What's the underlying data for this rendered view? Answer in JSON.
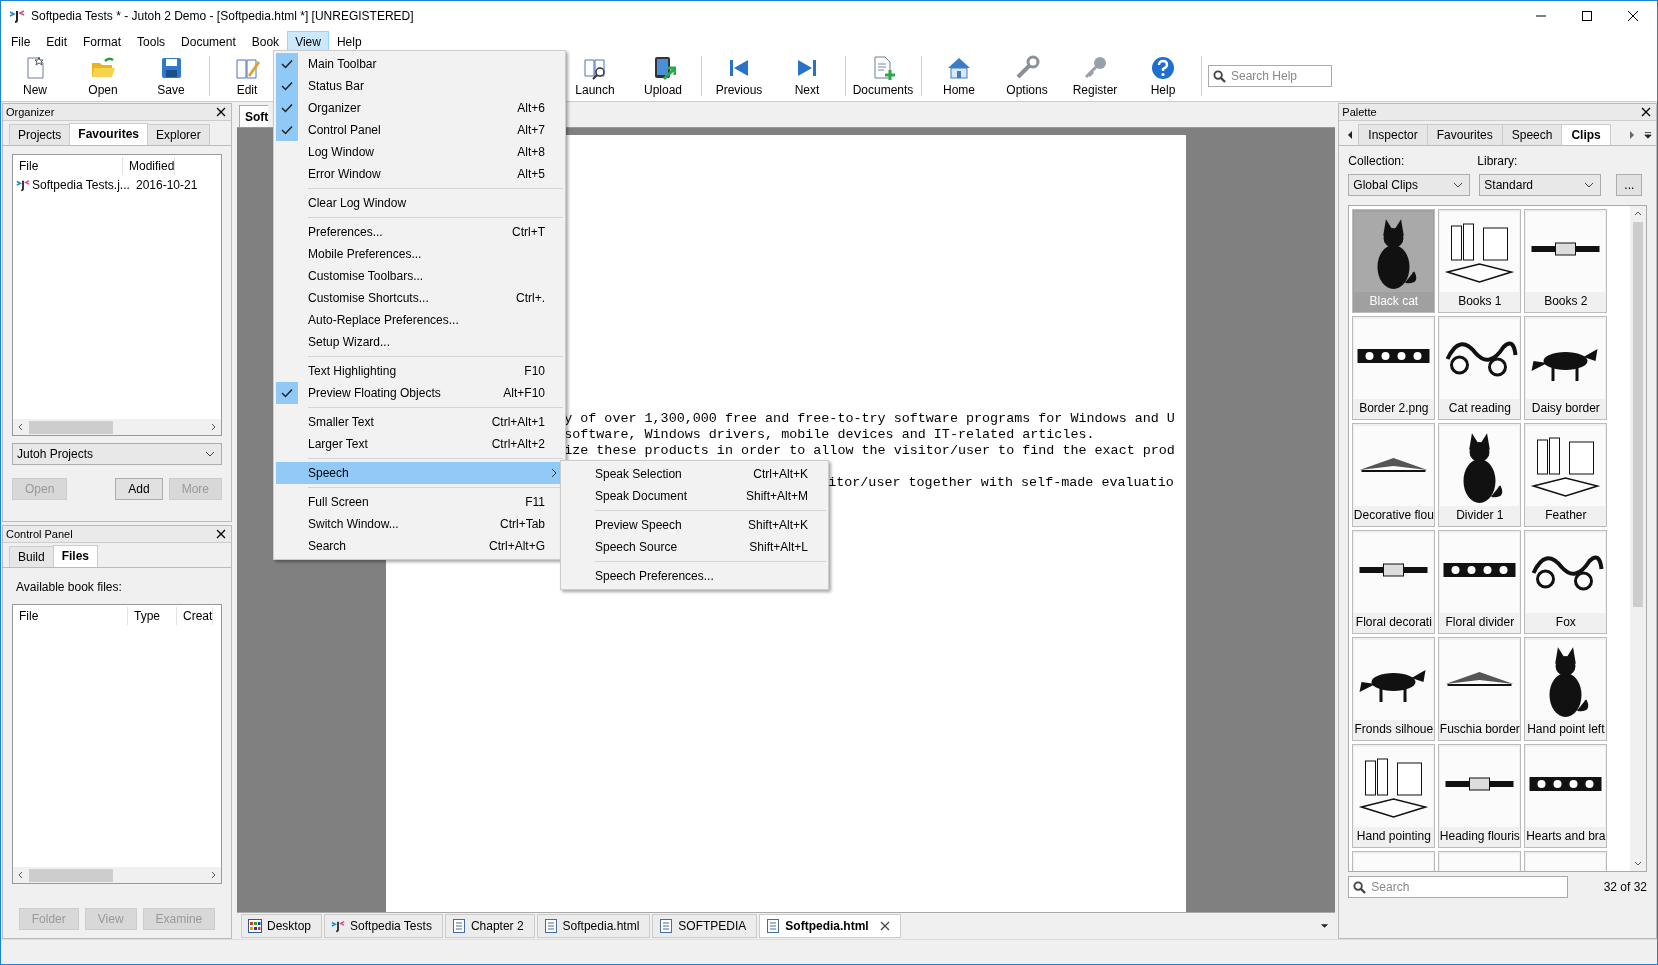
{
  "window": {
    "title": "Softpedia Tests * - Jutoh 2 Demo - [Softpedia.html *] [UNREGISTERED]"
  },
  "menu_bar": [
    {
      "label": "File",
      "selected": false
    },
    {
      "label": "Edit",
      "selected": false
    },
    {
      "label": "Format",
      "selected": false
    },
    {
      "label": "Tools",
      "selected": false
    },
    {
      "label": "Document",
      "selected": false
    },
    {
      "label": "Book",
      "selected": false
    },
    {
      "label": "View",
      "selected": true
    },
    {
      "label": "Help",
      "selected": false
    }
  ],
  "toolbar": {
    "buttons": [
      "New",
      "Open",
      "Save",
      "Edit",
      "Launch",
      "Upload",
      "Previous",
      "Next",
      "Documents",
      "Home",
      "Options",
      "Register",
      "Help"
    ],
    "search": {
      "placeholder": "Search Help"
    }
  },
  "organizer": {
    "title": "Organizer",
    "tabs": [
      {
        "label": "Projects",
        "selected": false
      },
      {
        "label": "Favourites",
        "selected": true
      },
      {
        "label": "Explorer",
        "selected": false
      }
    ],
    "columns": [
      "File",
      "Modified"
    ],
    "rows": [
      {
        "file": "Softpedia Tests.j...",
        "modified": "2016-10-21"
      }
    ],
    "dropdown": "Jutoh Projects",
    "buttons": [
      {
        "label": "Open",
        "disabled": true
      },
      {
        "label": "Add",
        "disabled": false
      },
      {
        "label": "More",
        "disabled": true
      }
    ]
  },
  "control_panel": {
    "title": "Control Panel",
    "tabs": [
      {
        "label": "Build",
        "selected": false
      },
      {
        "label": "Files",
        "selected": true
      }
    ],
    "caption": "Available book files:",
    "columns": [
      "File",
      "Type",
      "Creat"
    ],
    "buttons": [
      {
        "label": "Folder",
        "disabled": true
      },
      {
        "label": "View",
        "disabled": true
      },
      {
        "label": "Examine",
        "disabled": true
      }
    ]
  },
  "document": {
    "tab": "Soft",
    "lines": [
      "y of over 1,300,000 free and free-to-try software programs for Windows and U",
      "software, Windows drivers, mobile devices and IT-related articles.",
      "ize these products in order to allow the visitor/user to find the exact prod",
      "itor/user together with self-made evaluatio"
    ]
  },
  "document_tabs": [
    {
      "label": "Desktop",
      "kind": "desktop",
      "selected": false
    },
    {
      "label": "Softpedia Tests",
      "kind": "project",
      "selected": false
    },
    {
      "label": "Chapter 2",
      "kind": "page",
      "selected": false
    },
    {
      "label": "Softpedia.html",
      "kind": "page",
      "selected": false
    },
    {
      "label": "SOFTPEDIA",
      "kind": "page",
      "selected": false
    },
    {
      "label": "Softpedia.html",
      "kind": "page",
      "selected": true
    }
  ],
  "view_menu": {
    "groups": [
      [
        {
          "label": "Main Toolbar",
          "kind": "command",
          "checked": true,
          "selected": false
        },
        {
          "label": "Status Bar",
          "kind": "command",
          "checked": true,
          "selected": false
        },
        {
          "label": "Organizer",
          "shortcut": "Alt+6",
          "kind": "command",
          "checked": true,
          "selected": false
        },
        {
          "label": "Control Panel",
          "shortcut": "Alt+7",
          "kind": "command",
          "checked": true,
          "selected": false
        },
        {
          "label": "Log Window",
          "shortcut": "Alt+8",
          "kind": "command",
          "checked": false,
          "selected": false
        },
        {
          "label": "Error Window",
          "shortcut": "Alt+5",
          "kind": "command",
          "checked": false,
          "selected": false
        }
      ],
      [
        {
          "label": "Clear Log Window",
          "kind": "command",
          "checked": false,
          "selected": false
        }
      ],
      [
        {
          "label": "Preferences...",
          "shortcut": "Ctrl+T",
          "kind": "command",
          "checked": false,
          "selected": false
        },
        {
          "label": "Mobile Preferences...",
          "kind": "command",
          "checked": false,
          "selected": false
        },
        {
          "label": "Customise Toolbars...",
          "kind": "command",
          "checked": false,
          "selected": false
        },
        {
          "label": "Customise Shortcuts...",
          "shortcut": "Ctrl+.",
          "kind": "command",
          "checked": false,
          "selected": false
        },
        {
          "label": "Auto-Replace Preferences...",
          "kind": "command",
          "checked": false,
          "selected": false
        },
        {
          "label": "Setup Wizard...",
          "kind": "command",
          "checked": false,
          "selected": false
        }
      ],
      [
        {
          "label": "Text Highlighting",
          "shortcut": "F10",
          "kind": "command",
          "checked": false,
          "selected": false
        },
        {
          "label": "Preview Floating Objects",
          "shortcut": "Alt+F10",
          "kind": "command",
          "checked": true,
          "selected": false
        }
      ],
      [
        {
          "label": "Smaller Text",
          "shortcut": "Ctrl+Alt+1",
          "kind": "command",
          "checked": false,
          "selected": false
        },
        {
          "label": "Larger Text",
          "shortcut": "Ctrl+Alt+2",
          "kind": "command",
          "checked": false,
          "selected": false
        }
      ],
      [
        {
          "label": "Speech",
          "kind": "submenu",
          "checked": false,
          "selected": true
        }
      ],
      [
        {
          "label": "Full Screen",
          "shortcut": "F11",
          "kind": "command",
          "checked": false,
          "selected": false
        },
        {
          "label": "Switch Window...",
          "shortcut": "Ctrl+Tab",
          "kind": "command",
          "checked": false,
          "selected": false
        },
        {
          "label": "Search",
          "shortcut": "Ctrl+Alt+G",
          "kind": "command",
          "checked": false,
          "selected": false
        }
      ]
    ]
  },
  "speech_submenu": {
    "groups": [
      [
        {
          "label": "Speak Selection",
          "shortcut": "Ctrl+Alt+K"
        },
        {
          "label": "Speak Document",
          "shortcut": "Shift+Alt+M"
        }
      ],
      [
        {
          "label": "Preview Speech",
          "shortcut": "Shift+Alt+K"
        },
        {
          "label": "Speech Source",
          "shortcut": "Shift+Alt+L"
        }
      ],
      [
        {
          "label": "Speech Preferences..."
        }
      ]
    ]
  },
  "palette": {
    "title": "Palette",
    "tabs": [
      {
        "label": "Inspector",
        "selected": false
      },
      {
        "label": "Favourites",
        "selected": false
      },
      {
        "label": "Speech",
        "selected": false
      },
      {
        "label": "Clips",
        "selected": true
      }
    ],
    "collection_label": "Collection:",
    "collection": "Global Clips",
    "library_label": "Library:",
    "library": "Standard",
    "more_button": "...",
    "clips": [
      {
        "label": "Black cat",
        "selected": true
      },
      {
        "label": "Books 1",
        "selected": false
      },
      {
        "label": "Books 2",
        "selected": false
      },
      {
        "label": "Border 2.png",
        "selected": false
      },
      {
        "label": "Cat reading",
        "selected": false
      },
      {
        "label": "Daisy border",
        "selected": false
      },
      {
        "label": "Decorative flou",
        "selected": false
      },
      {
        "label": "Divider 1",
        "selected": false
      },
      {
        "label": "Feather",
        "selected": false
      },
      {
        "label": "Floral decorati",
        "selected": false
      },
      {
        "label": "Floral divider",
        "selected": false
      },
      {
        "label": "Fox",
        "selected": false
      },
      {
        "label": "Fronds silhoue",
        "selected": false
      },
      {
        "label": "Fuschia border",
        "selected": false
      },
      {
        "label": "Hand point left",
        "selected": false
      },
      {
        "label": "Hand pointing",
        "selected": false
      },
      {
        "label": "Heading flouris",
        "selected": false
      },
      {
        "label": "Hearts and bra",
        "selected": false
      },
      {
        "selected": false
      },
      {
        "selected": false
      },
      {
        "selected": false
      }
    ],
    "search": {
      "placeholder": "Search"
    },
    "count": "32 of 32"
  }
}
